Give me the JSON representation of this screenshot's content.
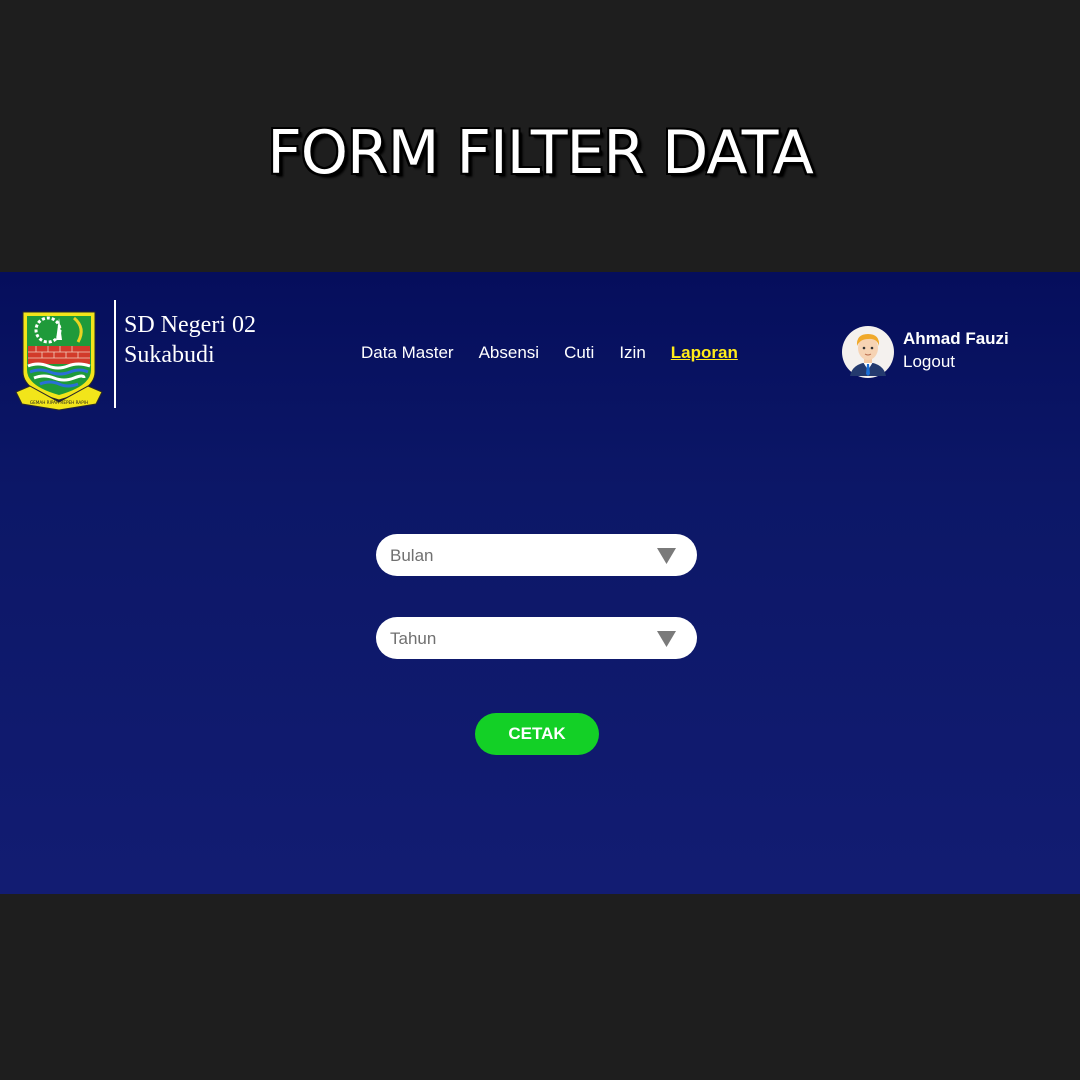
{
  "heading": "FORM FILTER DATA",
  "brand": {
    "name": "SD Negeri 02 Sukabudi",
    "logo_motto": "GEMAH RIPAH REPEH RAPIH"
  },
  "nav": {
    "items": [
      {
        "label": "Data Master",
        "active": false
      },
      {
        "label": "Absensi",
        "active": false
      },
      {
        "label": "Cuti",
        "active": false
      },
      {
        "label": "Izin",
        "active": false
      },
      {
        "label": "Laporan",
        "active": true
      }
    ]
  },
  "user": {
    "name": "Ahmad Fauzi",
    "logout_label": "Logout",
    "avatar_icon": "user-avatar-icon"
  },
  "form": {
    "month_placeholder": "Bulan",
    "year_placeholder": "Tahun",
    "submit_label": "CETAK"
  },
  "colors": {
    "background_dark": "#1e1e1e",
    "app_navy": "#0c1767",
    "active_nav": "#ffeb1a",
    "submit_green": "#13d026"
  }
}
